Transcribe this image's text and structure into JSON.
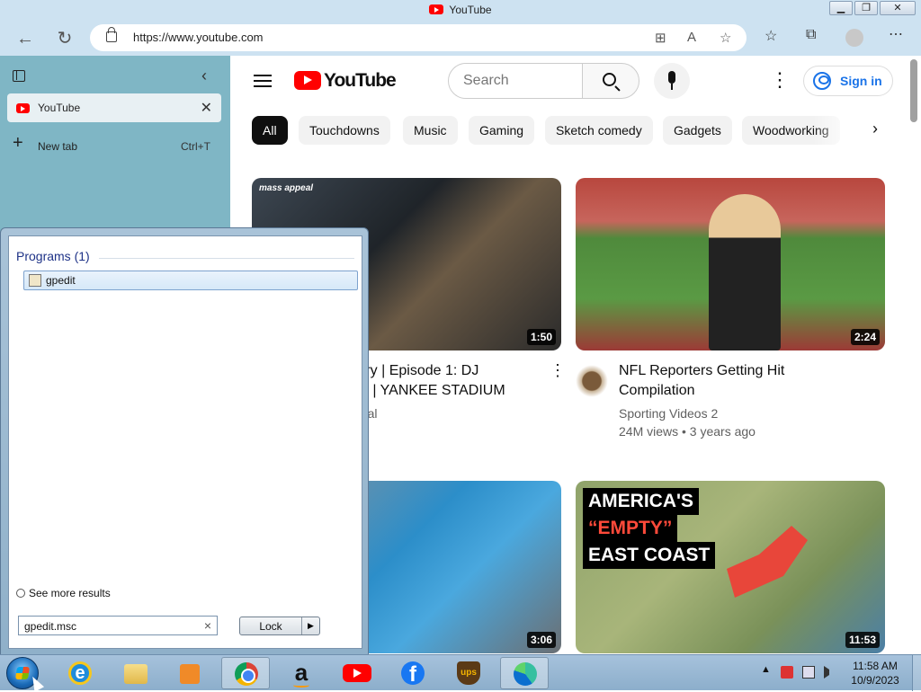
{
  "window": {
    "title": "YouTube",
    "buttons": [
      "❐",
      "❐",
      "✕"
    ]
  },
  "browser": {
    "url": "https://www.youtube.com",
    "tab": {
      "label": "YouTube"
    },
    "new_tab": {
      "label": "New tab",
      "shortcut": "Ctrl+T"
    }
  },
  "youtube": {
    "logo_text": "YouTube",
    "search_placeholder": "Search",
    "sign_in": "Sign in",
    "chips": [
      "All",
      "Touchdowns",
      "Music",
      "Gaming",
      "Sketch comedy",
      "Gadgets",
      "Woodworking"
    ],
    "videos": [
      {
        "title_lines": [
          "tory | Episode 1: DJ",
          "sh | YANKEE STADIUM"
        ],
        "channel": "peal",
        "duration": "1:50",
        "thumb_logo": "mass appeal"
      },
      {
        "title_lines": [
          "NFL Reporters Getting Hit",
          "Compilation"
        ],
        "channel": "Sporting Videos 2",
        "meta": "24M views • 3 years ago",
        "duration": "2:24"
      },
      {
        "duration": "3:06"
      },
      {
        "thumb_lines": [
          "AMERICA'S",
          "“EMPTY”",
          "EAST COAST"
        ],
        "duration": "11:53"
      }
    ]
  },
  "start_menu": {
    "section": "Programs (1)",
    "result": "gpedit",
    "see_more": "See more results",
    "search_value": "gpedit.msc",
    "lock": "Lock"
  },
  "taskbar": {
    "time": "11:58 AM",
    "date": "10/9/2023"
  }
}
